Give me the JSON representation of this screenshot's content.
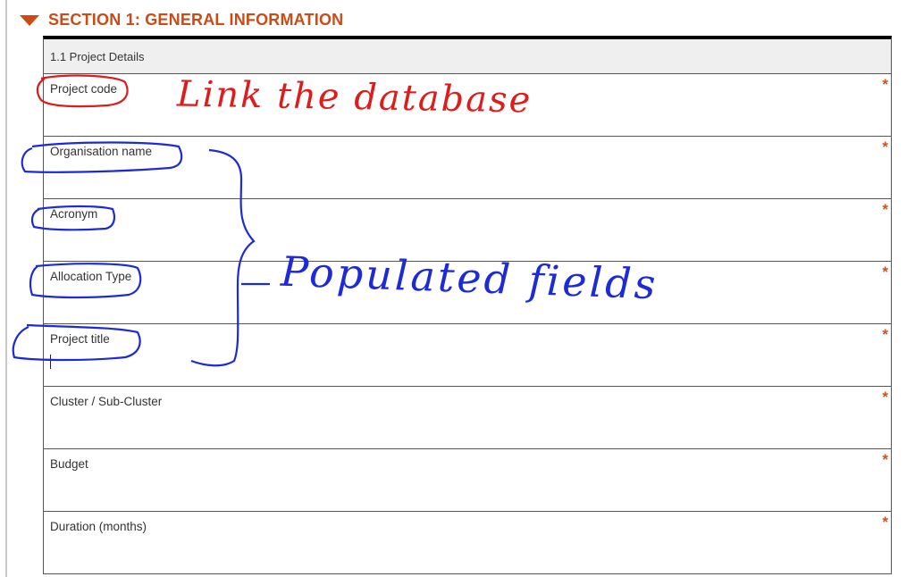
{
  "section": {
    "title": "SECTION 1: GENERAL INFORMATION"
  },
  "table": {
    "header": "1.1 Project Details",
    "rows": [
      {
        "label": "Project code",
        "required": "*"
      },
      {
        "label": "Organisation name",
        "required": "*"
      },
      {
        "label": "Acronym",
        "required": "*"
      },
      {
        "label": "Allocation Type",
        "required": "*"
      },
      {
        "label": "Project title",
        "required": "*"
      },
      {
        "label": "Cluster / Sub-Cluster",
        "required": "*"
      },
      {
        "label": "Budget",
        "required": "*"
      },
      {
        "label": "Duration (months)",
        "required": "*"
      }
    ]
  },
  "annotations": {
    "red_note": "Link the database",
    "blue_note": "Populated fields",
    "red_color": "#dd1c1c",
    "blue_color": "#1c2ad8"
  },
  "colors": {
    "accent": "#cc4a14",
    "required": "#d0521c"
  }
}
